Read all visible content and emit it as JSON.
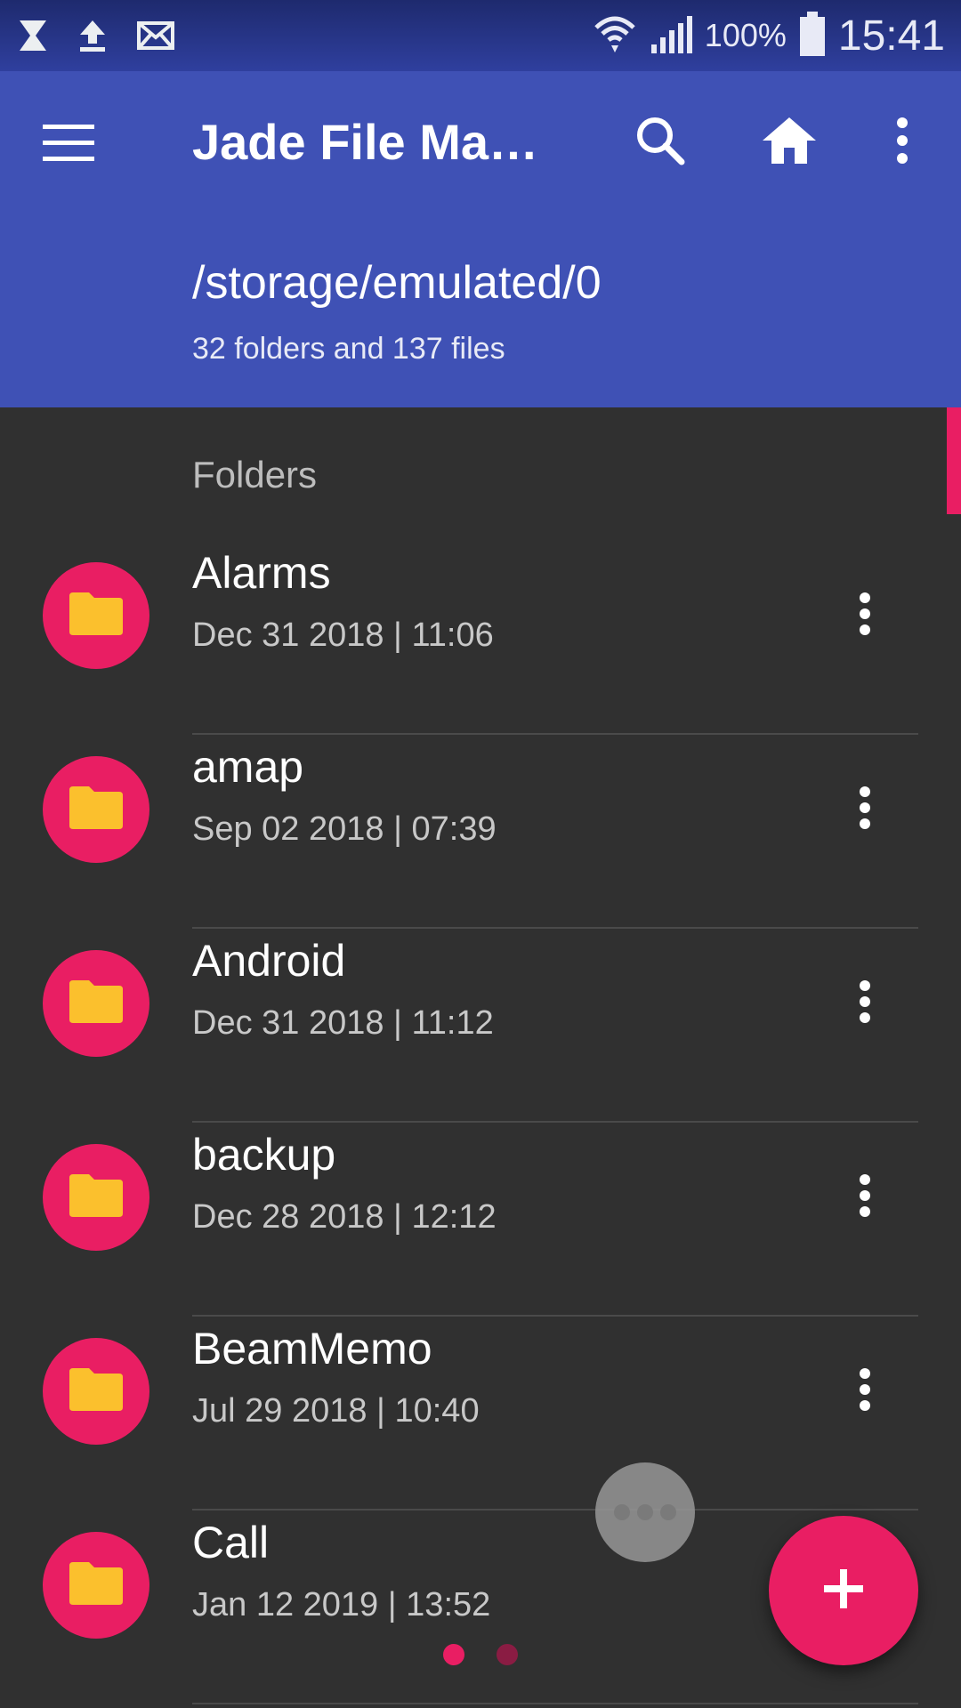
{
  "status_bar": {
    "left_icons": [
      "hourglass-icon",
      "upload-icon",
      "mail-icon"
    ],
    "right_icons": [
      "wifi-icon",
      "signal-icon",
      "battery-icon"
    ],
    "battery": "100%",
    "time": "15:41"
  },
  "app_bar": {
    "title": "Jade File Man…",
    "actions": [
      "search-icon",
      "home-icon",
      "more-vert-icon"
    ],
    "path": "/storage/emulated/0",
    "summary": "32 folders and 137 files"
  },
  "section": {
    "label": "Folders"
  },
  "folders": [
    {
      "name": "Alarms",
      "date": "Dec 31 2018 | 11:06"
    },
    {
      "name": "amap",
      "date": "Sep 02 2018 | 07:39"
    },
    {
      "name": "Android",
      "date": "Dec 31 2018 | 11:12"
    },
    {
      "name": "backup",
      "date": "Dec 28 2018 | 12:12"
    },
    {
      "name": "BeamMemo",
      "date": "Jul 29 2018 | 10:40"
    },
    {
      "name": "Call",
      "date": "Jan 12 2019 | 13:52"
    }
  ],
  "colors": {
    "primary": "#3f51b5",
    "accent": "#e91e63",
    "background": "#303030",
    "folder": "#fbc02d"
  },
  "fab": {
    "icon": "plus-icon"
  }
}
